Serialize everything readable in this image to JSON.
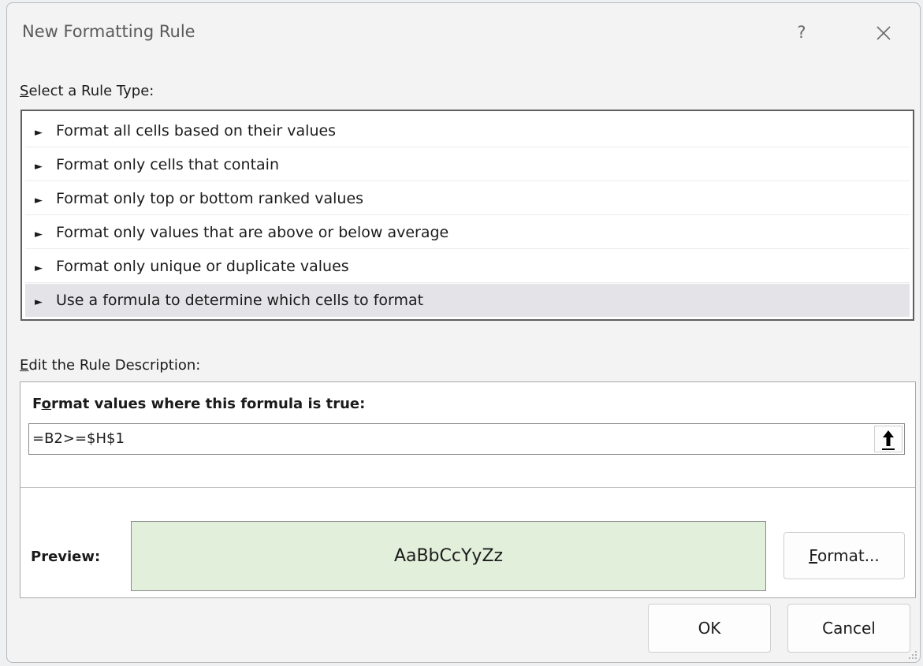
{
  "dialog": {
    "title": "New Formatting Rule",
    "help_label": "?"
  },
  "rule_type": {
    "label_access_key": "S",
    "label_rest": "elect a Rule Type:",
    "items": [
      {
        "label": "Format all cells based on their values",
        "selected": false
      },
      {
        "label": "Format only cells that contain",
        "selected": false
      },
      {
        "label": "Format only top or bottom ranked values",
        "selected": false
      },
      {
        "label": "Format only values that are above or below average",
        "selected": false
      },
      {
        "label": "Format only unique or duplicate values",
        "selected": false
      },
      {
        "label": "Use a formula to determine which cells to format",
        "selected": true
      }
    ]
  },
  "description": {
    "label_access_key": "E",
    "label_rest": "dit the Rule Description:",
    "heading_start": "F",
    "heading_access_key": "o",
    "heading_rest": "rmat values where this formula is true:",
    "formula_value": "=B2>=$H$1",
    "preview_label": "Preview:",
    "preview_text": "AaBbCcYyZz",
    "preview_fill": "#e2efdb",
    "format_access_key": "F",
    "format_rest": "ormat..."
  },
  "buttons": {
    "ok_label": "OK",
    "cancel_label": "Cancel"
  },
  "colors": {
    "selected_row": "#e4e4e8",
    "dialog_background": "#f3f3f3"
  },
  "icons": {
    "arrow": "►",
    "close": "close-icon",
    "collapse": "arrow-up-icon",
    "grip": "resize-grip-icon"
  }
}
